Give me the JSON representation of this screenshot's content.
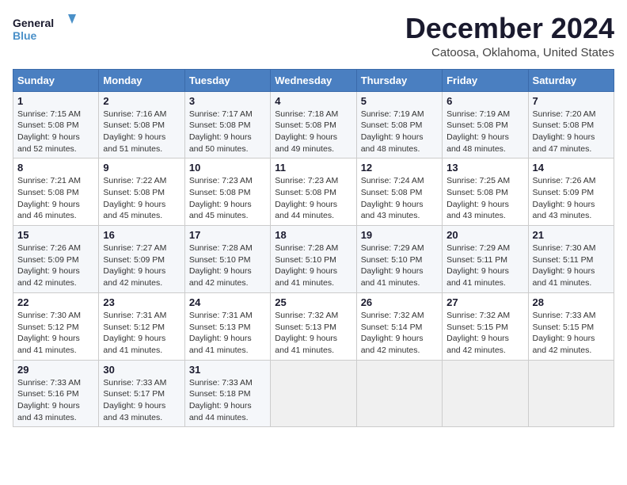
{
  "header": {
    "logo_line1": "General",
    "logo_line2": "Blue",
    "month_title": "December 2024",
    "subtitle": "Catoosa, Oklahoma, United States"
  },
  "days_of_week": [
    "Sunday",
    "Monday",
    "Tuesday",
    "Wednesday",
    "Thursday",
    "Friday",
    "Saturday"
  ],
  "weeks": [
    [
      {
        "day": "1",
        "sunrise": "7:15 AM",
        "sunset": "5:08 PM",
        "daylight": "9 hours and 52 minutes."
      },
      {
        "day": "2",
        "sunrise": "7:16 AM",
        "sunset": "5:08 PM",
        "daylight": "9 hours and 51 minutes."
      },
      {
        "day": "3",
        "sunrise": "7:17 AM",
        "sunset": "5:08 PM",
        "daylight": "9 hours and 50 minutes."
      },
      {
        "day": "4",
        "sunrise": "7:18 AM",
        "sunset": "5:08 PM",
        "daylight": "9 hours and 49 minutes."
      },
      {
        "day": "5",
        "sunrise": "7:19 AM",
        "sunset": "5:08 PM",
        "daylight": "9 hours and 48 minutes."
      },
      {
        "day": "6",
        "sunrise": "7:19 AM",
        "sunset": "5:08 PM",
        "daylight": "9 hours and 48 minutes."
      },
      {
        "day": "7",
        "sunrise": "7:20 AM",
        "sunset": "5:08 PM",
        "daylight": "9 hours and 47 minutes."
      }
    ],
    [
      {
        "day": "8",
        "sunrise": "7:21 AM",
        "sunset": "5:08 PM",
        "daylight": "9 hours and 46 minutes."
      },
      {
        "day": "9",
        "sunrise": "7:22 AM",
        "sunset": "5:08 PM",
        "daylight": "9 hours and 45 minutes."
      },
      {
        "day": "10",
        "sunrise": "7:23 AM",
        "sunset": "5:08 PM",
        "daylight": "9 hours and 45 minutes."
      },
      {
        "day": "11",
        "sunrise": "7:23 AM",
        "sunset": "5:08 PM",
        "daylight": "9 hours and 44 minutes."
      },
      {
        "day": "12",
        "sunrise": "7:24 AM",
        "sunset": "5:08 PM",
        "daylight": "9 hours and 43 minutes."
      },
      {
        "day": "13",
        "sunrise": "7:25 AM",
        "sunset": "5:08 PM",
        "daylight": "9 hours and 43 minutes."
      },
      {
        "day": "14",
        "sunrise": "7:26 AM",
        "sunset": "5:09 PM",
        "daylight": "9 hours and 43 minutes."
      }
    ],
    [
      {
        "day": "15",
        "sunrise": "7:26 AM",
        "sunset": "5:09 PM",
        "daylight": "9 hours and 42 minutes."
      },
      {
        "day": "16",
        "sunrise": "7:27 AM",
        "sunset": "5:09 PM",
        "daylight": "9 hours and 42 minutes."
      },
      {
        "day": "17",
        "sunrise": "7:28 AM",
        "sunset": "5:10 PM",
        "daylight": "9 hours and 42 minutes."
      },
      {
        "day": "18",
        "sunrise": "7:28 AM",
        "sunset": "5:10 PM",
        "daylight": "9 hours and 41 minutes."
      },
      {
        "day": "19",
        "sunrise": "7:29 AM",
        "sunset": "5:10 PM",
        "daylight": "9 hours and 41 minutes."
      },
      {
        "day": "20",
        "sunrise": "7:29 AM",
        "sunset": "5:11 PM",
        "daylight": "9 hours and 41 minutes."
      },
      {
        "day": "21",
        "sunrise": "7:30 AM",
        "sunset": "5:11 PM",
        "daylight": "9 hours and 41 minutes."
      }
    ],
    [
      {
        "day": "22",
        "sunrise": "7:30 AM",
        "sunset": "5:12 PM",
        "daylight": "9 hours and 41 minutes."
      },
      {
        "day": "23",
        "sunrise": "7:31 AM",
        "sunset": "5:12 PM",
        "daylight": "9 hours and 41 minutes."
      },
      {
        "day": "24",
        "sunrise": "7:31 AM",
        "sunset": "5:13 PM",
        "daylight": "9 hours and 41 minutes."
      },
      {
        "day": "25",
        "sunrise": "7:32 AM",
        "sunset": "5:13 PM",
        "daylight": "9 hours and 41 minutes."
      },
      {
        "day": "26",
        "sunrise": "7:32 AM",
        "sunset": "5:14 PM",
        "daylight": "9 hours and 42 minutes."
      },
      {
        "day": "27",
        "sunrise": "7:32 AM",
        "sunset": "5:15 PM",
        "daylight": "9 hours and 42 minutes."
      },
      {
        "day": "28",
        "sunrise": "7:33 AM",
        "sunset": "5:15 PM",
        "daylight": "9 hours and 42 minutes."
      }
    ],
    [
      {
        "day": "29",
        "sunrise": "7:33 AM",
        "sunset": "5:16 PM",
        "daylight": "9 hours and 43 minutes."
      },
      {
        "day": "30",
        "sunrise": "7:33 AM",
        "sunset": "5:17 PM",
        "daylight": "9 hours and 43 minutes."
      },
      {
        "day": "31",
        "sunrise": "7:33 AM",
        "sunset": "5:18 PM",
        "daylight": "9 hours and 44 minutes."
      },
      null,
      null,
      null,
      null
    ]
  ],
  "labels": {
    "sunrise": "Sunrise:",
    "sunset": "Sunset:",
    "daylight": "Daylight:"
  }
}
